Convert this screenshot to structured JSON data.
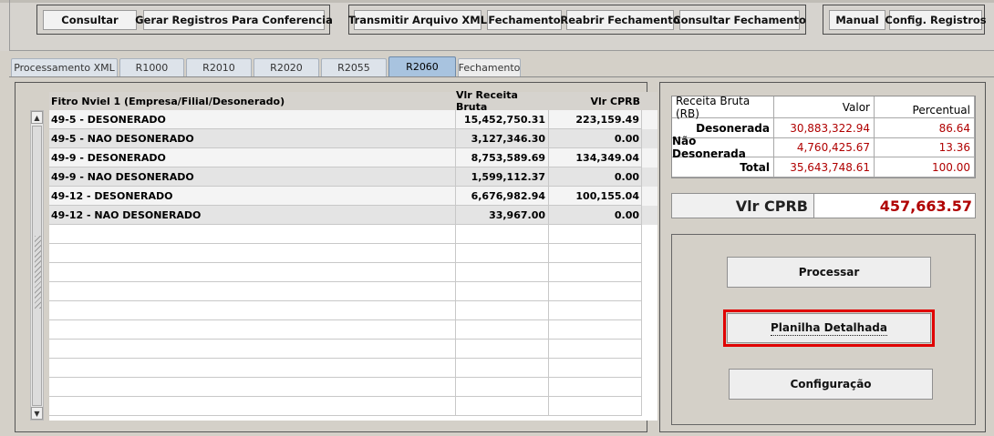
{
  "toolbar": {
    "groups": [
      {
        "buttons": [
          "Consultar",
          "Gerar Registros Para Conferencia"
        ]
      },
      {
        "buttons": [
          "Transmitir Arquivo XML",
          "Fechamento",
          "Reabrir Fechamento",
          "Consultar Fechamento"
        ]
      },
      {
        "buttons": [
          "Manual",
          "Config. Registros"
        ]
      }
    ]
  },
  "tabs": [
    {
      "label": "Processamento XML",
      "active": false
    },
    {
      "label": "R1000",
      "active": false
    },
    {
      "label": "R2010",
      "active": false
    },
    {
      "label": "R2020",
      "active": false
    },
    {
      "label": "R2055",
      "active": false
    },
    {
      "label": "R2060",
      "active": true
    },
    {
      "label": "Fechamento",
      "active": false
    }
  ],
  "grid": {
    "columns": [
      "Fitro Nviel 1 (Empresa/Filial/Desonerado)",
      "Vlr Receita Bruta",
      "Vlr CPRB"
    ],
    "rows": [
      {
        "filter": "49-5 - DESONERADO",
        "receita": "15,452,750.31",
        "cprb": "223,159.49"
      },
      {
        "filter": "49-5 - NAO DESONERADO",
        "receita": "3,127,346.30",
        "cprb": "0.00"
      },
      {
        "filter": "49-9 - DESONERADO",
        "receita": "8,753,589.69",
        "cprb": "134,349.04"
      },
      {
        "filter": "49-9 - NAO DESONERADO",
        "receita": "1,599,112.37",
        "cprb": "0.00"
      },
      {
        "filter": "49-12 - DESONERADO",
        "receita": "6,676,982.94",
        "cprb": "100,155.04"
      },
      {
        "filter": "49-12 - NAO DESONERADO",
        "receita": "33,967.00",
        "cprb": "0.00"
      }
    ]
  },
  "summary": {
    "headers": [
      "Receita Bruta (RB)",
      "Valor",
      "Percentual"
    ],
    "rows": [
      {
        "label": "Desonerada",
        "valor": "30,883,322.94",
        "percentual": "86.64"
      },
      {
        "label": "Não Desonerada",
        "valor": "4,760,425.67",
        "percentual": "13.36"
      },
      {
        "label": "Total",
        "valor": "35,643,748.61",
        "percentual": "100.00"
      }
    ]
  },
  "cprb": {
    "label": "Vlr CPRB",
    "value": "457,663.57"
  },
  "actions": {
    "processar": "Processar",
    "planilha": "Planilha Detalhada",
    "configuracao": "Configuração"
  },
  "colors": {
    "accent_red": "#b00000",
    "highlight": "#e00000",
    "active_tab": "#a8c3df"
  }
}
